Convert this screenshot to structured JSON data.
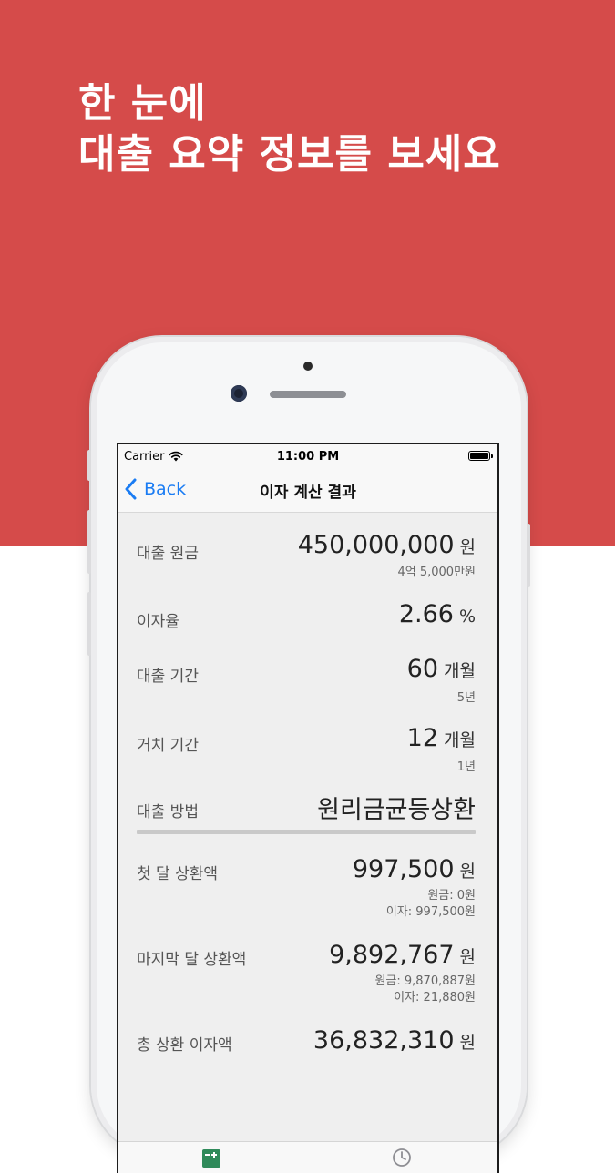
{
  "headline": {
    "line1": "한 눈에",
    "line2": "대출 요약 정보를 보세요"
  },
  "status_bar": {
    "carrier": "Carrier",
    "time": "11:00 PM"
  },
  "nav": {
    "back_label": "Back",
    "title": "이자 계산 결과"
  },
  "rows": [
    {
      "label": "대출 원금",
      "value": "450,000,000",
      "unit": "원",
      "sub": [
        "4억 5,000만원"
      ]
    },
    {
      "label": "이자율",
      "value": "2.66",
      "unit": "%",
      "sub": []
    },
    {
      "label": "대출 기간",
      "value": "60",
      "unit": "개월",
      "sub": [
        "5년"
      ]
    },
    {
      "label": "거치 기간",
      "value": "12",
      "unit": "개월",
      "sub": [
        "1년"
      ]
    },
    {
      "label": "대출 방법",
      "value": "원리금균등상환",
      "unit": "",
      "sub": []
    },
    {
      "label": "첫 달 상환액",
      "value": "997,500",
      "unit": "원",
      "sub": [
        "원금: 0원",
        "이자: 997,500원"
      ]
    },
    {
      "label": "마지막 달 상환액",
      "value": "9,892,767",
      "unit": "원",
      "sub": [
        "원금: 9,870,887원",
        "이자: 21,880원"
      ]
    },
    {
      "label": "총 상환 이자액",
      "value": "36,832,310",
      "unit": "원",
      "sub": []
    }
  ],
  "colors": {
    "brand_red": "#d54b4a",
    "link_blue": "#1a7cf3",
    "tab_green": "#2f8a5a"
  },
  "icons": {
    "back": "chevron-left-icon",
    "wifi": "wifi-icon",
    "battery": "battery-icon",
    "tab_calc": "calculator-icon",
    "tab_history": "history-clock-icon"
  }
}
